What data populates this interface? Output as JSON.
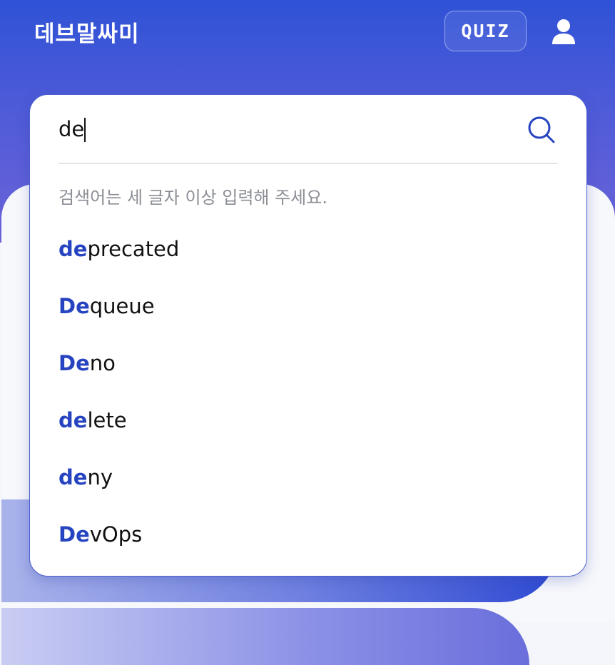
{
  "header": {
    "logo_text": "데브말싸미",
    "quiz_label": "QUIZ",
    "user_icon": "user-icon"
  },
  "search": {
    "value": "de",
    "search_icon": "search-icon",
    "hint": "검색어는 세 글자 이상 입력해 주세요.",
    "suggestions": [
      {
        "match": "de",
        "rest": "precated"
      },
      {
        "match": "De",
        "rest": "queue"
      },
      {
        "match": "De",
        "rest": "no"
      },
      {
        "match": "de",
        "rest": "lete"
      },
      {
        "match": "de",
        "rest": "ny"
      },
      {
        "match": "De",
        "rest": "vOps"
      }
    ]
  },
  "colors": {
    "header_top": "#2f52d6",
    "header_bottom": "#6b63d8",
    "match_highlight": "#2744c0",
    "panel_border": "#4a5fd0",
    "hint_text": "#8b8e95"
  }
}
